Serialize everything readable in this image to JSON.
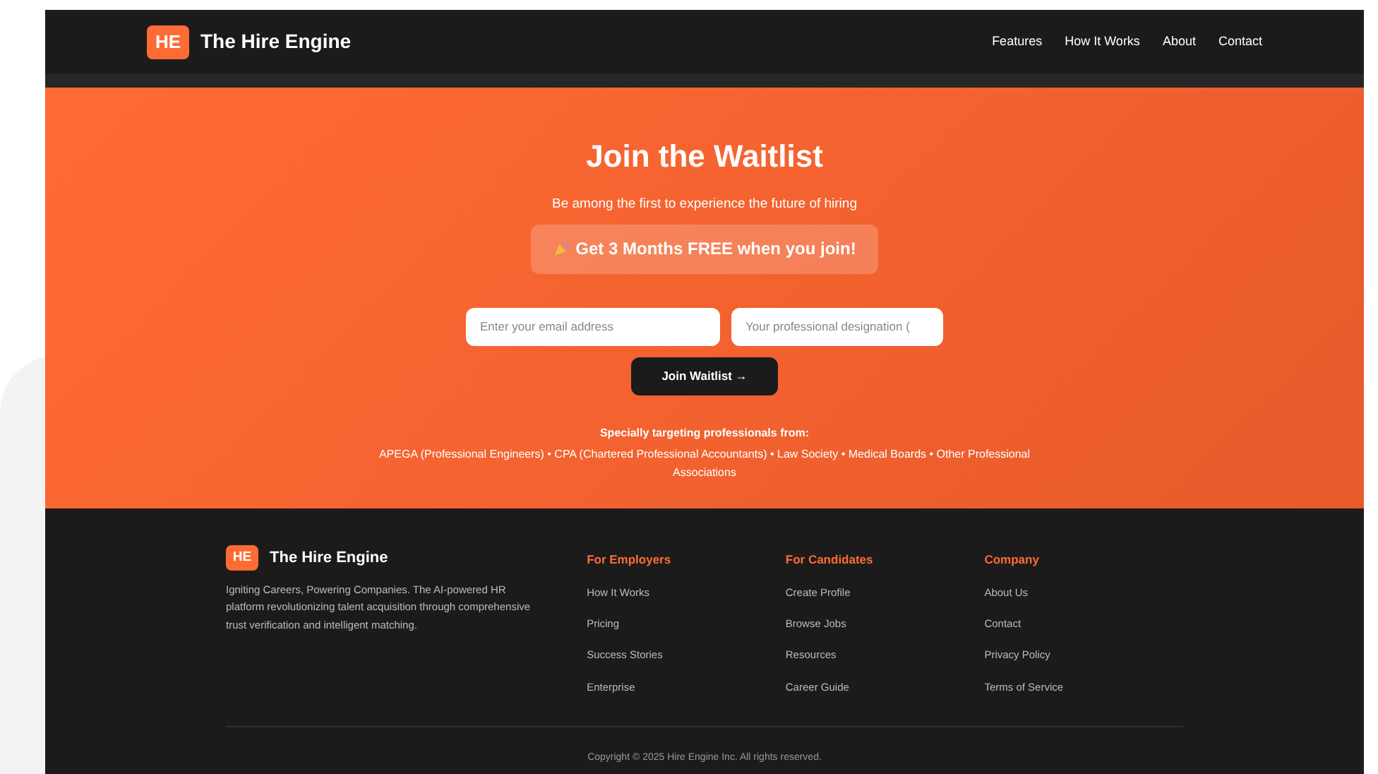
{
  "navbar": {
    "logo_mark": "HE",
    "brand": "The Hire Engine",
    "links": [
      "Features",
      "How It Works",
      "About",
      "Contact"
    ]
  },
  "hero": {
    "title": "Join the Waitlist",
    "subtitle": "Be among the first to experience the future of hiring",
    "offer": "Get 3 Months FREE when you join!",
    "email_field": {
      "placeholder": "Enter your email address"
    },
    "designation_field": {
      "placeholder": "Your professional designation ("
    },
    "submit": "Join Waitlist →",
    "targeting_heading": "Specially targeting professionals from:",
    "targeting_list": "APEGA (Professional Engineers) • CPA (Chartered Professional Accountants) • Law Society • Medical Boards • Other Professional Associations"
  },
  "footer": {
    "logo_mark": "HE",
    "brand": "The Hire Engine",
    "tagline": "Igniting Careers, Powering Companies. The AI-powered HR platform revolutionizing talent acquisition through comprehensive trust verification and intelligent matching.",
    "columns": [
      {
        "heading": "For Employers",
        "links": [
          "How It Works",
          "Pricing",
          "Success Stories",
          "Enterprise"
        ]
      },
      {
        "heading": "For Candidates",
        "links": [
          "Create Profile",
          "Browse Jobs",
          "Resources",
          "Career Guide"
        ]
      },
      {
        "heading": "Company",
        "links": [
          "About Us",
          "Contact",
          "Privacy Policy",
          "Terms of Service"
        ]
      }
    ],
    "copyright": "Copyright © 2025 Hire Engine Inc. All rights reserved."
  }
}
